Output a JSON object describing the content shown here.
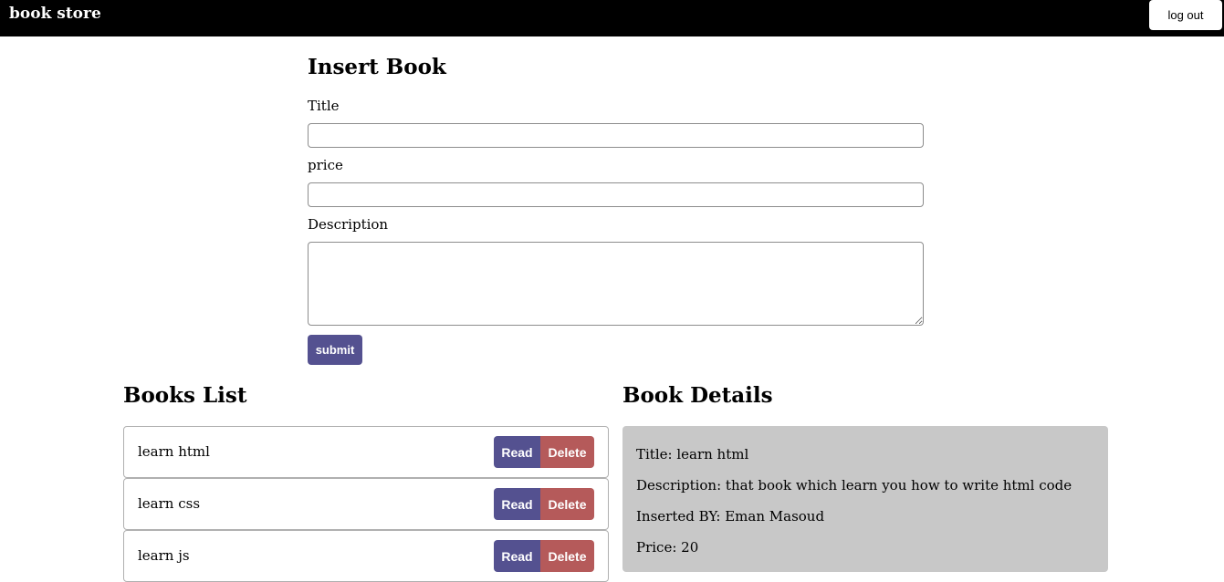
{
  "navbar": {
    "brand": "book store",
    "logout_label": "log out"
  },
  "insert_form": {
    "heading": "Insert Book",
    "title_label": "Title",
    "title_value": "",
    "price_label": "price",
    "price_value": "",
    "description_label": "Description",
    "description_value": "",
    "submit_label": "submit"
  },
  "books_list": {
    "heading": "Books List",
    "read_label": "Read",
    "delete_label": "Delete",
    "items": [
      {
        "name": "learn html"
      },
      {
        "name": "learn css"
      },
      {
        "name": "learn js"
      }
    ]
  },
  "book_details": {
    "heading": "Book Details",
    "title_line": "Title: learn html",
    "description_line": "Description: that book which learn you how to write html code",
    "inserted_by_line": "Inserted BY: Eman Masoud",
    "price_line": "Price: 20"
  },
  "colors": {
    "navbar_bg": "#000000",
    "primary_button": "#545190",
    "danger_button": "#b55a5a",
    "details_bg": "#c8c8c8"
  }
}
